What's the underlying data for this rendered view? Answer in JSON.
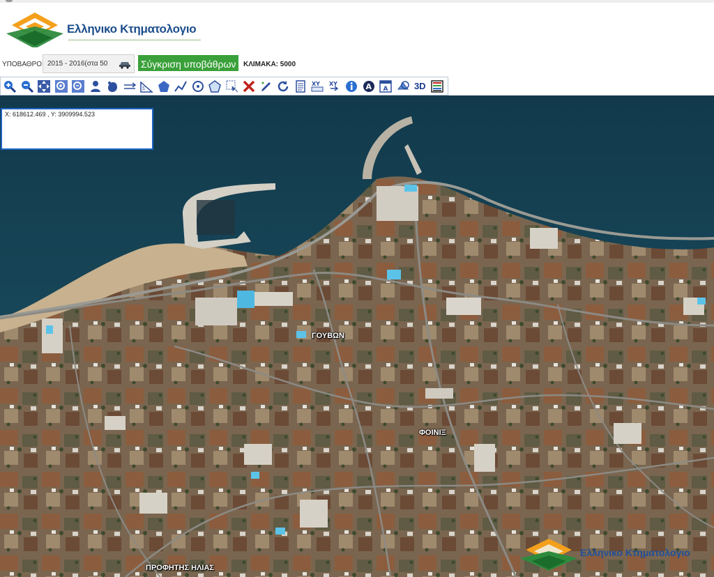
{
  "header": {
    "brand": "Ελληνικο Κτηματολογιο"
  },
  "basebar": {
    "label": "ΥΠΟΒΑΘΡΟ:",
    "selected": "2015 - 2016(στα 50",
    "compare_button": "Σύγκριση υποβάθρων",
    "scale": "ΚΛΙΜΑΚΑ: 5000"
  },
  "toolbar": {
    "tools": [
      "zoom-in",
      "zoom-out",
      "pan",
      "zoom-box",
      "zoom-full",
      "identify",
      "hand-select",
      "measure-distance",
      "measure-angle",
      "measure-area",
      "draw-line",
      "draw-circle",
      "select-polygon",
      "select-box",
      "clear",
      "edit",
      "refresh",
      "report",
      "xy-coordinates",
      "xy-goto",
      "info",
      "annotation",
      "print",
      "layers",
      "3D",
      "legend"
    ],
    "label_3d": "3D",
    "label_xy": "XY"
  },
  "map": {
    "coords_text": "X: 618612.469 , Y: 3909994.523",
    "places": [
      "ΓΟΥΒΩΝ",
      "ΦΟΙΝΙΞ",
      "ΠΡΟΦΗΤΗΣ ΗΛΙΑΣ"
    ],
    "watermark": "Ελληνικο Κτηματολογιο"
  },
  "colors": {
    "brand_blue": "#1c4e8c",
    "compare_green": "#3aa03a",
    "coords_border": "#1e63c4",
    "sea": "#17475a",
    "land": "#7d6a52"
  }
}
